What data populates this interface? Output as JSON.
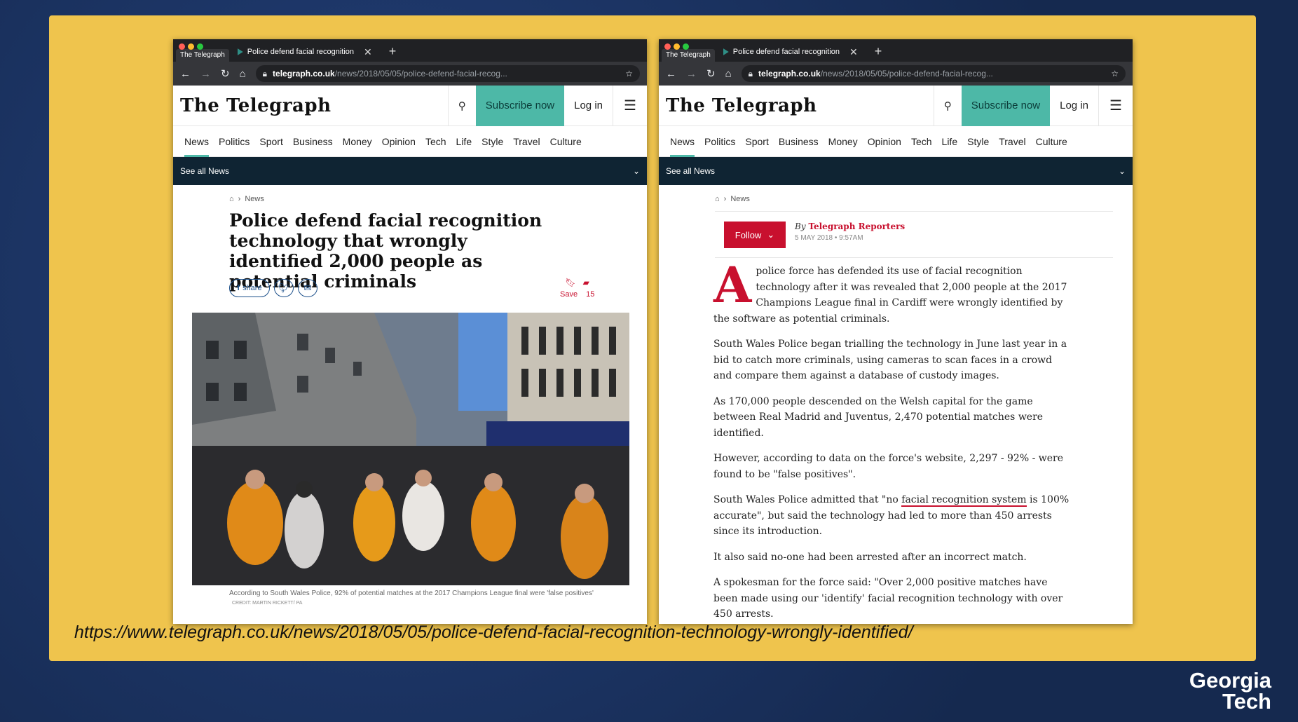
{
  "slide": {
    "url": "https://www.telegraph.co.uk/news/2018/05/05/police-defend-facial-recognition-technology-wrongly-identified/",
    "logo_line1": "Georgia",
    "logo_line2": "Tech"
  },
  "browser": {
    "small_tab": "The Telegraph",
    "tab_title": "Police defend facial recognition",
    "domain": "telegraph.co.uk",
    "path": "/news/2018/05/05/police-defend-facial-recog..."
  },
  "site": {
    "logo": "The Telegraph",
    "subscribe": "Subscribe now",
    "login": "Log in",
    "nav": [
      "News",
      "Politics",
      "Sport",
      "Business",
      "Money",
      "Opinion",
      "Tech",
      "Life",
      "Style",
      "Travel",
      "Culture"
    ],
    "see_all": "See all News",
    "crumb": "News"
  },
  "left_article": {
    "headline": "Police defend facial recognition technology that wrongly identified 2,000 people as potential criminals",
    "share_label": "share",
    "save_label": "Save",
    "comment_count": "15",
    "caption": "According to South Wales Police, 92% of potential matches at the 2017 Champions League final were 'false positives'",
    "credit": "CREDIT: MARTIN RICKETT/ PA"
  },
  "right_article": {
    "follow": "Follow",
    "by": "By",
    "author": "Telegraph Reporters",
    "date": "5 MAY 2018 • 9:57AM",
    "dropcap": "A",
    "p1": "police force has defended its use of facial recognition technology after it was revealed that 2,000 people at the 2017 Champions League final in Cardiff were wrongly identified by the software as potential criminals.",
    "p2": "South Wales Police began trialling the technology in June last year in a bid to catch more criminals, using cameras to scan faces in a crowd and compare them against a database of custody images.",
    "p3": "As 170,000 people descended on the Welsh capital for the game between Real Madrid and Juventus, 2,470 potential matches were identified.",
    "p4": "However, according to data on the force's website, 2,297 - 92% - were found to be \"false positives\".",
    "p5_a": "South Wales Police admitted that \"no ",
    "p5_link": "facial recognition system",
    "p5_b": " is 100% accurate\", but said the technology had led to more than 450 arrests since its introduction.",
    "p6": "It also said no-one had been arrested after an incorrect match.",
    "p7": "A spokesman for the force said: \"Over 2,000 positive matches have been made using our 'identify' facial recognition technology with over 450 arrests."
  }
}
